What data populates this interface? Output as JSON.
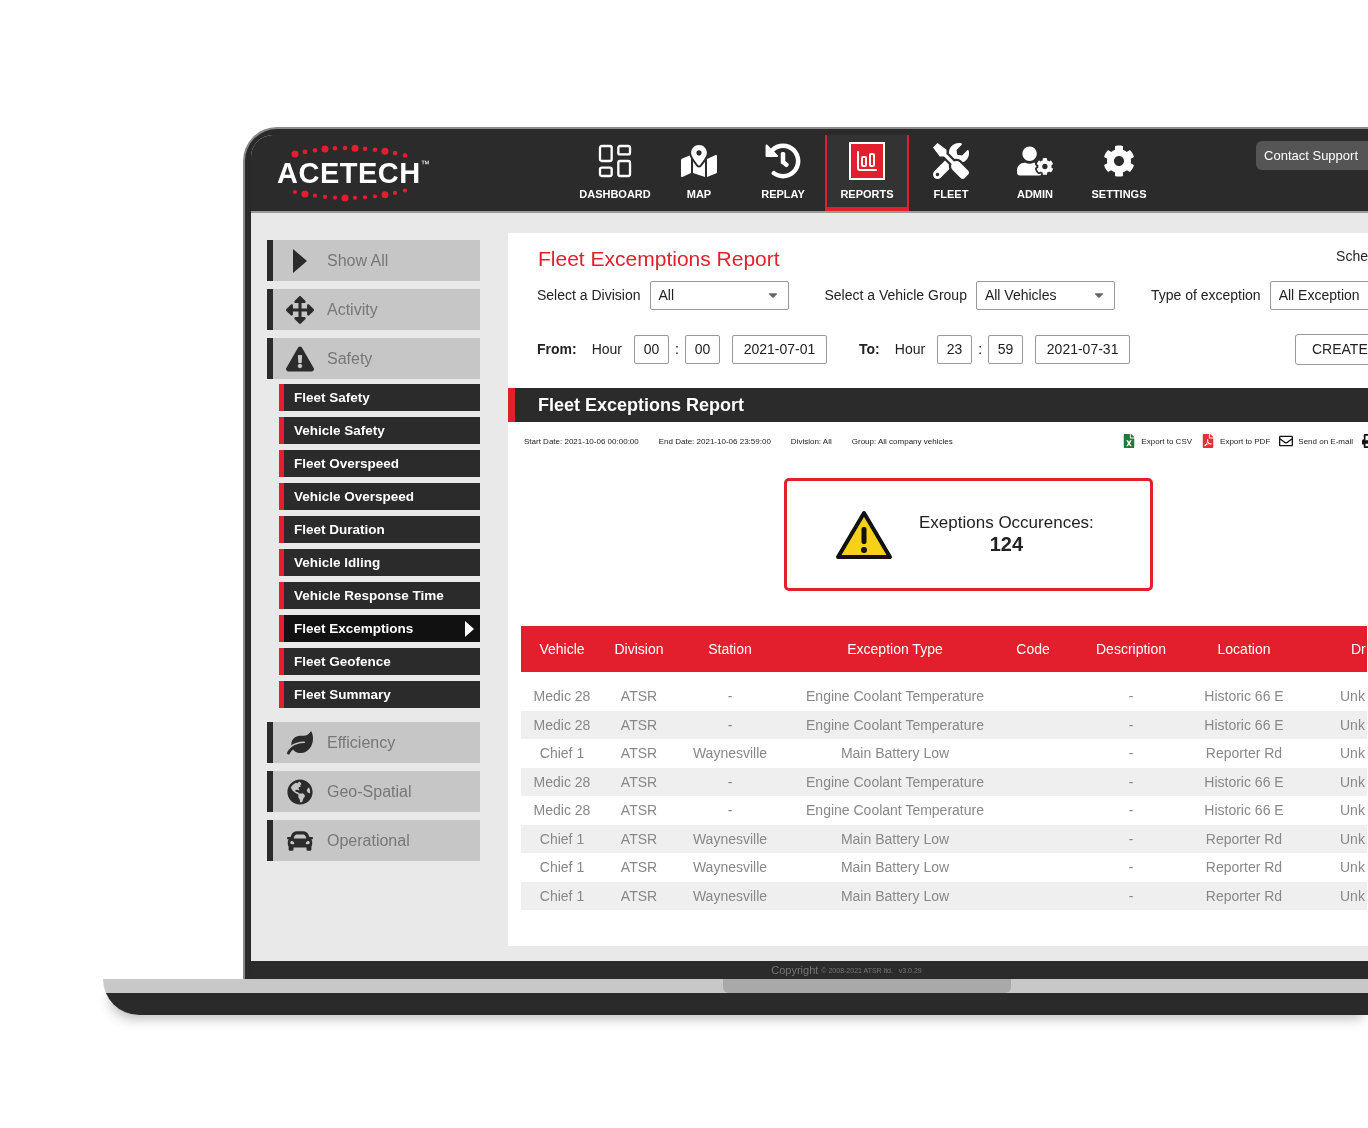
{
  "brand": {
    "name": "ACETECH",
    "mark": "™"
  },
  "nav": [
    {
      "label": "DASHBOARD",
      "selected": false
    },
    {
      "label": "MAP",
      "selected": false
    },
    {
      "label": "REPLAY",
      "selected": false
    },
    {
      "label": "REPORTS",
      "selected": true
    },
    {
      "label": "FLEET",
      "selected": false
    },
    {
      "label": "ADMIN",
      "selected": false
    },
    {
      "label": "SETTINGS",
      "selected": false
    }
  ],
  "support_button": "Contact Support",
  "sidebar": [
    {
      "label": "Show All"
    },
    {
      "label": "Activity"
    },
    {
      "label": "Safety",
      "children": [
        {
          "label": "Fleet Safety",
          "selected": false
        },
        {
          "label": "Vehicle Safety",
          "selected": false
        },
        {
          "label": "Fleet Overspeed",
          "selected": false
        },
        {
          "label": "Vehicle Overspeed",
          "selected": false
        },
        {
          "label": "Fleet Duration",
          "selected": false
        },
        {
          "label": "Vehicle Idling",
          "selected": false
        },
        {
          "label": "Vehicle Response Time",
          "selected": false
        },
        {
          "label": "Fleet Excemptions",
          "selected": true
        },
        {
          "label": "Fleet Geofence",
          "selected": false
        },
        {
          "label": "Fleet Summary",
          "selected": false
        }
      ]
    },
    {
      "label": "Efficiency"
    },
    {
      "label": "Geo-Spatial"
    },
    {
      "label": "Operational"
    }
  ],
  "report": {
    "title": "Fleet Excemptions Report",
    "schedule_link": "Sche",
    "filters": [
      {
        "label": "Select a Division",
        "value": "All"
      },
      {
        "label": "Select a Vehicle Group",
        "value": "All Vehicles"
      },
      {
        "label": "Type of exception",
        "value": "All Exception"
      }
    ],
    "from": {
      "label": "From:",
      "hour_label": "Hour",
      "hour": "00",
      "separator": ":",
      "minute": "00",
      "date": "2021-07-01"
    },
    "to": {
      "label": "To:",
      "hour_label": "Hour",
      "hour": "23",
      "separator": ":",
      "minute": "59",
      "date": "2021-07-31"
    },
    "create_button": "CREATE"
  },
  "results": {
    "title": "Fleet Exceptions Report",
    "meta": [
      "Start Date: 2021-10-06  00:00:00",
      "End Date: 2021-10-06  23:59:00",
      "Division: All",
      "Group: All company vehicles"
    ],
    "exports": [
      "Export to CSV",
      "Export to PDF",
      "Send on E-mail"
    ],
    "summary": {
      "label": "Exeptions Occurences:",
      "count": "124"
    }
  },
  "table": {
    "columns": [
      "Vehicle",
      "Division",
      "Station",
      "Exception Type",
      "Code",
      "Description",
      "Location",
      "Dr"
    ],
    "rows": [
      [
        "Medic 28",
        "ATSR",
        "-",
        "Engine Coolant Temperature",
        "",
        "-",
        "Historic 66 E",
        "Unk"
      ],
      [
        "Medic 28",
        "ATSR",
        "-",
        "Engine Coolant Temperature",
        "",
        "-",
        "Historic 66 E",
        "Unk"
      ],
      [
        "Chief 1",
        "ATSR",
        "Waynesville",
        "Main Battery Low",
        "",
        "-",
        "Reporter Rd",
        "Unk"
      ],
      [
        "Medic 28",
        "ATSR",
        "-",
        "Engine Coolant Temperature",
        "",
        "-",
        "Historic 66 E",
        "Unk"
      ],
      [
        "Medic 28",
        "ATSR",
        "-",
        "Engine Coolant Temperature",
        "",
        "-",
        "Historic 66 E",
        "Unk"
      ],
      [
        "Chief 1",
        "ATSR",
        "Waynesville",
        "Main Battery Low",
        "",
        "-",
        "Reporter Rd",
        "Unk"
      ],
      [
        "Chief 1",
        "ATSR",
        "Waynesville",
        "Main Battery Low",
        "",
        "-",
        "Reporter Rd",
        "Unk"
      ],
      [
        "Chief 1",
        "ATSR",
        "Waynesville",
        "Main Battery Low",
        "",
        "-",
        "Reporter Rd",
        "Unk"
      ]
    ]
  },
  "footer": {
    "copyright": "Copyright",
    "notice": "© 2008-2021 ATSR ltd.   v3.0.29"
  }
}
